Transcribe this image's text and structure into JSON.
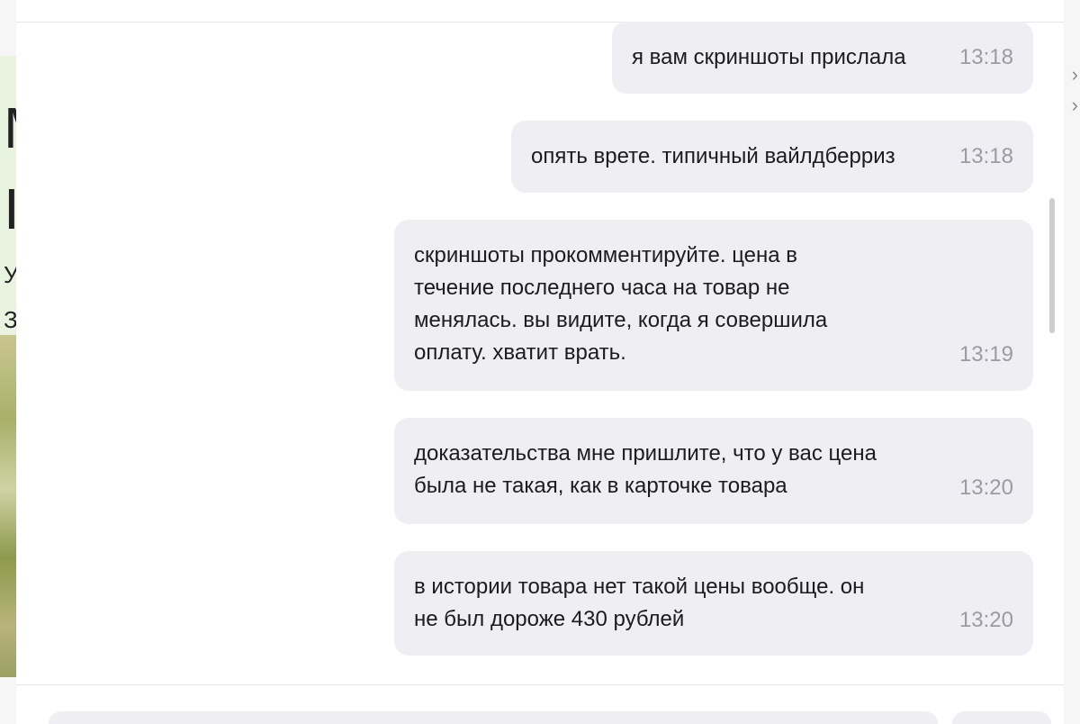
{
  "background_page": {
    "letters": [
      "M",
      "I",
      "У",
      "З"
    ]
  },
  "chat": {
    "messages": [
      {
        "text": "я вам скриншоты прислала",
        "time": "13:18"
      },
      {
        "text": "опять врете. типичный вайлдберриз",
        "time": "13:18"
      },
      {
        "text": "скриншоты прокомментируйте. цена в\nтечение последнего часа на товар не\nменялась. вы видите, когда я совершила\nоплату. хватит врать.",
        "time": "13:19"
      },
      {
        "text": "доказательства мне пришлите, что у вас цена\nбыла не такая, как в карточке товара",
        "time": "13:20"
      },
      {
        "text": "в истории товара нет такой цены вообще. он\nне был дороже 430 рублей",
        "time": "13:20"
      }
    ]
  },
  "colors": {
    "bubble": "#eeeef3",
    "time": "#9b9ba3",
    "text": "#1c1c1e"
  }
}
